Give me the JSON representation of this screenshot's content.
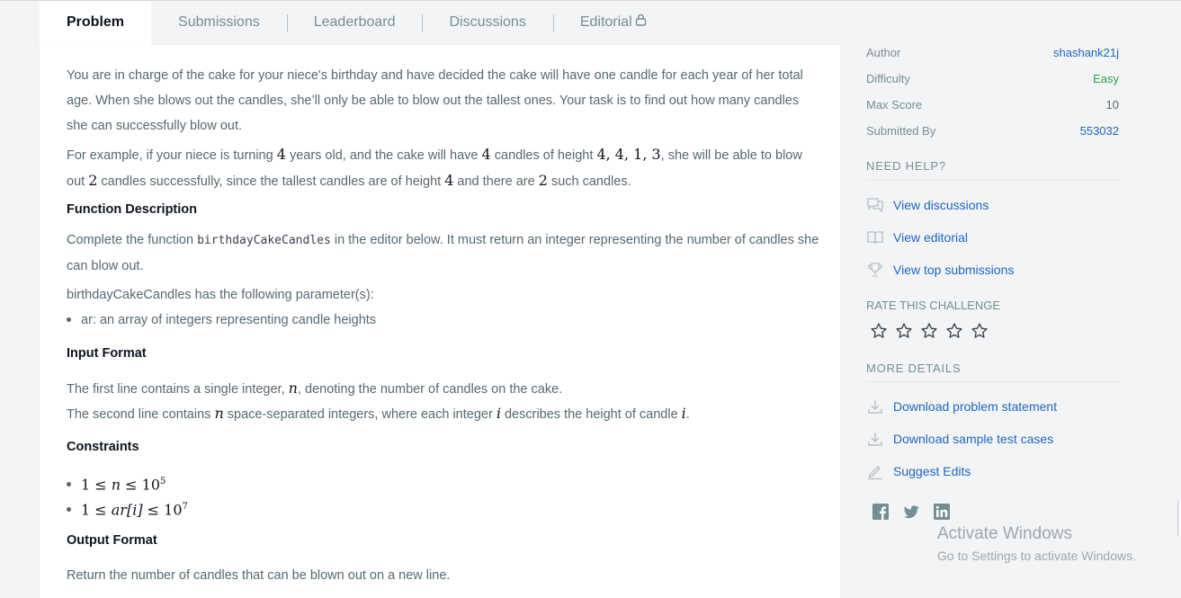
{
  "tabs": [
    {
      "label": "Problem"
    },
    {
      "label": "Submissions"
    },
    {
      "label": "Leaderboard"
    },
    {
      "label": "Discussions"
    },
    {
      "label": "Editorial"
    }
  ],
  "problem": {
    "intro": "You are in charge of the cake for your niece's birthday and have decided the cake will have one candle for each year of her total age. When she blows out the candles, she’ll only be able to blow out the tallest ones. Your task is to find out how many candles she can successfully blow out.",
    "example_1": "For example, if your niece is turning",
    "example_age": "4",
    "example_2": "years old, and the cake will have",
    "example_count": "4",
    "example_3": "candles of height",
    "example_heights": "4, 4, 1, 3",
    "example_4": ", she will be able to blow out",
    "example_result": "2",
    "example_5": "candles successfully, since the tallest candles are of height",
    "example_tallest": "4",
    "example_6": "and there are",
    "example_num": "2",
    "example_7": "such candles.",
    "func_heading": "Function Description",
    "func_1": "Complete the function",
    "func_name": "birthdayCakeCandles",
    "func_2": "in the editor below. It must return an integer representing the number of candles she can blow out.",
    "params_line": "birthdayCakeCandles has the following parameter(s):",
    "param_ar": "ar: an array of integers representing candle heights",
    "input_heading": "Input Format",
    "input_1a": "The first line contains a single integer,",
    "input_1_var": "n",
    "input_1b": ", denoting the number of candles on the cake.",
    "input_2a": "The second line contains",
    "input_2_var": "n",
    "input_2b": "space-separated integers, where each integer",
    "input_2_var2": "i",
    "input_2c": "describes the height of candle",
    "input_2_var3": "i",
    "input_2d": ".",
    "constraints_heading": "Constraints",
    "c1_left": "1 ≤",
    "c1_var": "n",
    "c1_right": "≤ 10",
    "c1_exp": "5",
    "c2_left": "1 ≤",
    "c2_var": "ar[i]",
    "c2_right": "≤ 10",
    "c2_exp": "7",
    "output_heading": "Output Format",
    "output_text": "Return the number of candles that can be blown out on a new line."
  },
  "sidebar": {
    "meta": [
      {
        "key": "Author",
        "value": "shashank21j"
      },
      {
        "key": "Difficulty",
        "value": "Easy"
      },
      {
        "key": "Max Score",
        "value": "10"
      },
      {
        "key": "Submitted By",
        "value": "553032"
      }
    ],
    "need_help_title": "NEED HELP?",
    "help_links": [
      "View discussions",
      "View editorial",
      "View top submissions"
    ],
    "rate_title": "RATE THIS CHALLENGE",
    "rating": 0,
    "more_title": "MORE DETAILS",
    "more_links": [
      "Download problem statement",
      "Download sample test cases",
      "Suggest Edits"
    ]
  },
  "watermark": {
    "line1": "Activate Windows",
    "line2": "Go to Settings to activate Windows."
  },
  "colors": {
    "link": "#1f66c1",
    "easy": "#2ea44f",
    "background": "#f3f4f5"
  }
}
